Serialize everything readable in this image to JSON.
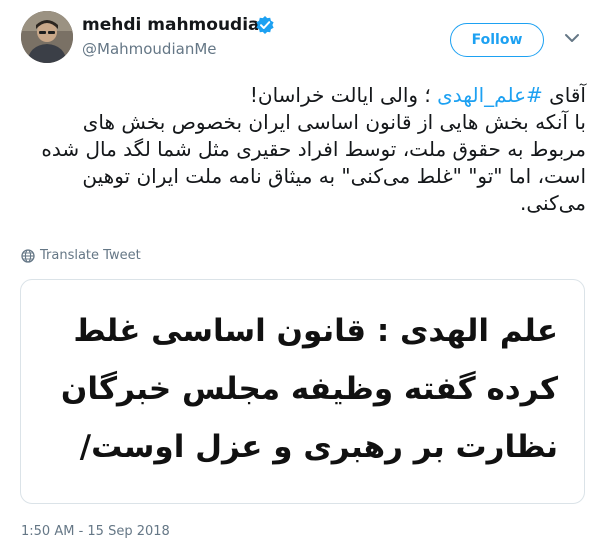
{
  "user": {
    "display_name": "mehdi mahmoudian",
    "screen_name": "@MahmoudianMe",
    "verified": true,
    "avatar_icon": "profile-photo"
  },
  "follow_label": "Follow",
  "tweet": {
    "line1_prefix": "آقای ",
    "hashtag": "#علم_الهدی",
    "line1_suffix": " ؛ والی ایالت خراسان!",
    "body": "با آنکه بخش هایی از قانون اساسی ایران بخصوص بخش های مربوط به حقوق ملت، توسط افراد حقیری مثل شما لگد مال شده است، اما \"تو\" \"غلط می‌کنی\" به میثاق نامه ملت ایران توهین می‌کنی."
  },
  "translate_label": "Translate Tweet",
  "media": {
    "lines": [
      "علم الهدی : قانون اساسی غلط",
      "کرده گفته وظیفه مجلس خبرگان",
      "نظارت بر رهبری و عزل اوست/"
    ]
  },
  "timestamp": "1:50 AM - 15 Sep 2018",
  "colors": {
    "accent": "#1da1f2",
    "secondary_text": "#657786",
    "primary_text": "#14171a",
    "border": "#dbe3e8"
  }
}
